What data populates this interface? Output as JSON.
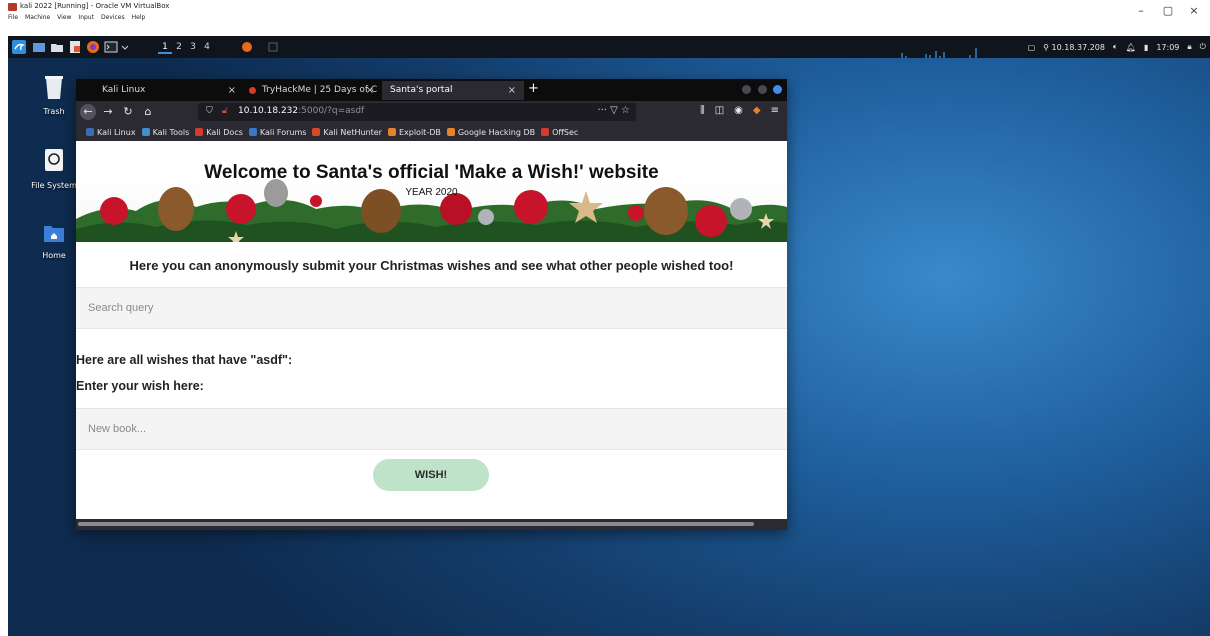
{
  "vbox": {
    "title": "kali 2022 [Running] - Oracle VM VirtualBox",
    "menu": [
      "File",
      "Machine",
      "View",
      "Input",
      "Devices",
      "Help"
    ],
    "controls": {
      "minimize": "–",
      "restore": "▢",
      "close": "×"
    }
  },
  "kali_panel": {
    "workspaces": [
      "1",
      "2",
      "3",
      "4"
    ],
    "active_workspace": "1",
    "ip": "10.18.37.208",
    "clock": "17:09"
  },
  "desktop": {
    "icons": [
      {
        "label": "Trash"
      },
      {
        "label": "File System"
      },
      {
        "label": "Home"
      }
    ]
  },
  "firefox": {
    "tabs": [
      {
        "label": "Kali Linux"
      },
      {
        "label": "TryHackMe | 25 Days of C"
      },
      {
        "label": "Santa's portal"
      }
    ],
    "newtab": "+",
    "url": {
      "host": "10.10.18.232",
      "rest": ":5000/?q=asdf"
    },
    "url_icons": "··· ▽ ☆",
    "bookmarks": [
      {
        "label": "Kali Linux",
        "color": "#3d6bb3"
      },
      {
        "label": "Kali Tools",
        "color": "#3d8fd0"
      },
      {
        "label": "Kali Docs",
        "color": "#d43a2f"
      },
      {
        "label": "Kali Forums",
        "color": "#3a78c8"
      },
      {
        "label": "Kali NetHunter",
        "color": "#d44b2a"
      },
      {
        "label": "Exploit-DB",
        "color": "#e8822a"
      },
      {
        "label": "Google Hacking DB",
        "color": "#e8822a"
      },
      {
        "label": "OffSec",
        "color": "#d43a2f"
      }
    ]
  },
  "page": {
    "title": "Welcome to Santa's official 'Make a Wish!' website",
    "subtitle": "YEAR 2020",
    "intro": "Here you can anonymously submit your Christmas wishes and see what other people wished too!",
    "search_placeholder": "Search query",
    "wishes_heading": "Here are all wishes that have \"asdf\":",
    "enter_label": "Enter your wish here:",
    "wish_placeholder": "New book...",
    "wish_button": "WISH!"
  },
  "colors": {
    "accent": "#3e8fe8",
    "wish_button": "#bfe3c9",
    "desktop": "#1f5f9e"
  }
}
